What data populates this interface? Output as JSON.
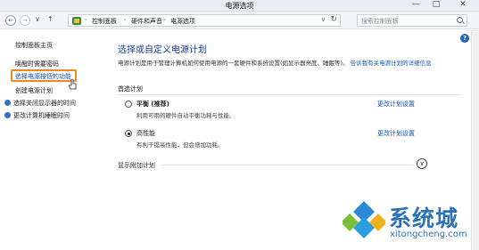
{
  "window": {
    "title": "电源选项",
    "min_glyph": "—",
    "max_glyph": "□",
    "close_glyph": "✕"
  },
  "nav": {
    "back_glyph": "←",
    "forward_glyph": "→",
    "recent_glyph": "∨",
    "up_glyph": "↑"
  },
  "breadcrumb": {
    "items": [
      "控制面板",
      "硬件和声音",
      "电源选项"
    ],
    "separator": "›",
    "dropdown_glyph": "∨",
    "refresh_glyph": "↻"
  },
  "search": {
    "placeholder": "搜索控制面板"
  },
  "help": {
    "glyph": "?"
  },
  "sidebar": {
    "home_label": "控制面板主页",
    "items": [
      {
        "label": "唤醒时需要密码"
      },
      {
        "label": "选择电源按钮的功能"
      },
      {
        "label": "创建电源计划"
      },
      {
        "label": "选择关闭显示器的时间"
      },
      {
        "label": "更改计算机睡眠时间"
      }
    ]
  },
  "main": {
    "title": "选择或自定义电源计划",
    "description": "电源计划是用于管理计算机如何使用电源的一套硬件和系统设置(如显示器亮度、睡眠等)。",
    "description_link": "告诉我有关电源计划的详细信息",
    "preferred_label": "首选计划",
    "plans": [
      {
        "name": "平衡 (推荐)",
        "desc": "利用可用的硬件自动平衡功耗与性能。",
        "link": "更改计划设置",
        "selected": false
      },
      {
        "name": "高性能",
        "desc": "有利于提高性能，但会增加功耗。",
        "link": "更改计划设置",
        "selected": true
      }
    ],
    "extra_label": "显示附加计划",
    "expand_glyph": "∨"
  },
  "watermark": {
    "brand": "系统城",
    "url": "xitongcheng.com"
  },
  "colors": {
    "link": "#1a55b8",
    "title": "#1a3a8a",
    "highlight_border": "#ef8a1f",
    "watermark": "#2a73b8"
  }
}
